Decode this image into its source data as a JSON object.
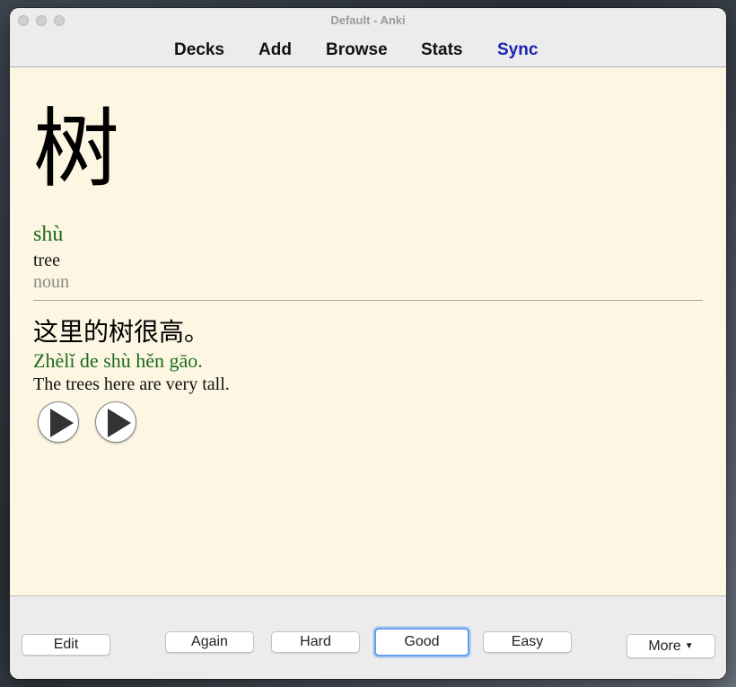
{
  "window": {
    "title": "Default - Anki"
  },
  "toolbar": {
    "items": [
      {
        "label": "Decks",
        "color": "#111111"
      },
      {
        "label": "Add",
        "color": "#111111"
      },
      {
        "label": "Browse",
        "color": "#111111"
      },
      {
        "label": "Stats",
        "color": "#111111"
      },
      {
        "label": "Sync",
        "color": "#1a22b8"
      }
    ]
  },
  "card": {
    "character": "树",
    "pinyin": "shù",
    "meaning": "tree",
    "part_of_speech": "noun",
    "sentence": "这里的树很高。",
    "sentence_pinyin": "Zhèlǐ de shù hěn gāo.",
    "sentence_translation": "The trees here are very tall.",
    "audio_buttons": [
      "play-icon",
      "play-icon"
    ],
    "background": "#fdf6e3",
    "pinyin_color": "#1a6b1a"
  },
  "bottom": {
    "edit_label": "Edit",
    "answers": [
      {
        "label": "Again"
      },
      {
        "label": "Hard"
      },
      {
        "label": "Good",
        "default": true
      },
      {
        "label": "Easy"
      }
    ],
    "more_label": "More",
    "more_icon": "chevron-down-icon"
  }
}
